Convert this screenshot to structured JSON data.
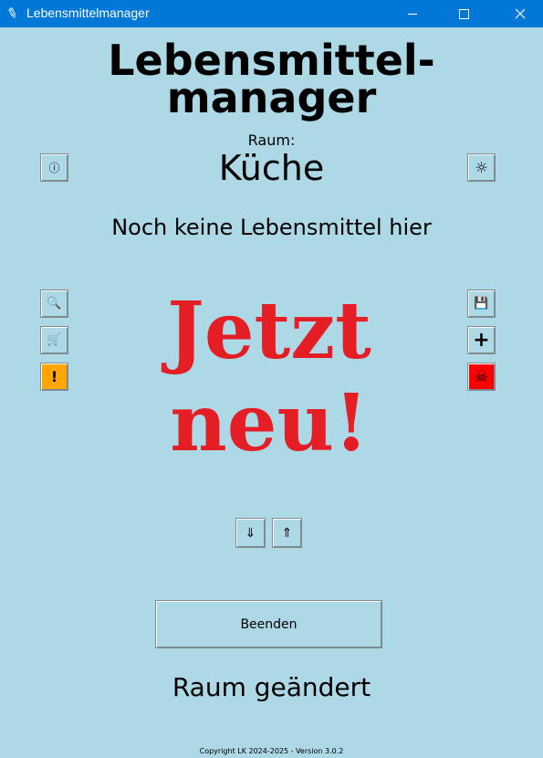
{
  "window": {
    "title": "Lebensmittelmanager",
    "icon": "feather-icon",
    "controls": [
      "minimize-icon",
      "maximize-icon",
      "close-icon"
    ]
  },
  "header": {
    "title_line1": "Lebensmittel-",
    "title_line2": "manager"
  },
  "room": {
    "label": "Raum:",
    "name": "Küche"
  },
  "empty_message": "Noch keine Lebensmittel hier",
  "splash": {
    "line1": "Jetzt",
    "line2": "neu!",
    "color": "#e51d25"
  },
  "buttons": {
    "info": "ⓘ",
    "settings": "☼",
    "search": "🔍",
    "cart": "🛒",
    "warning": "!",
    "save": "💾",
    "add": "+",
    "danger": "☠",
    "down": "⇓",
    "up": "⇑"
  },
  "colors": {
    "background": "#add8e6",
    "titlebar": "#0078d7",
    "warning_button": "#ffa500",
    "danger_button": "#ff0000"
  },
  "quit_label": "Beenden",
  "status": "Raum geändert",
  "footer": "Copyright LK 2024-2025  -  Version 3.0.2"
}
